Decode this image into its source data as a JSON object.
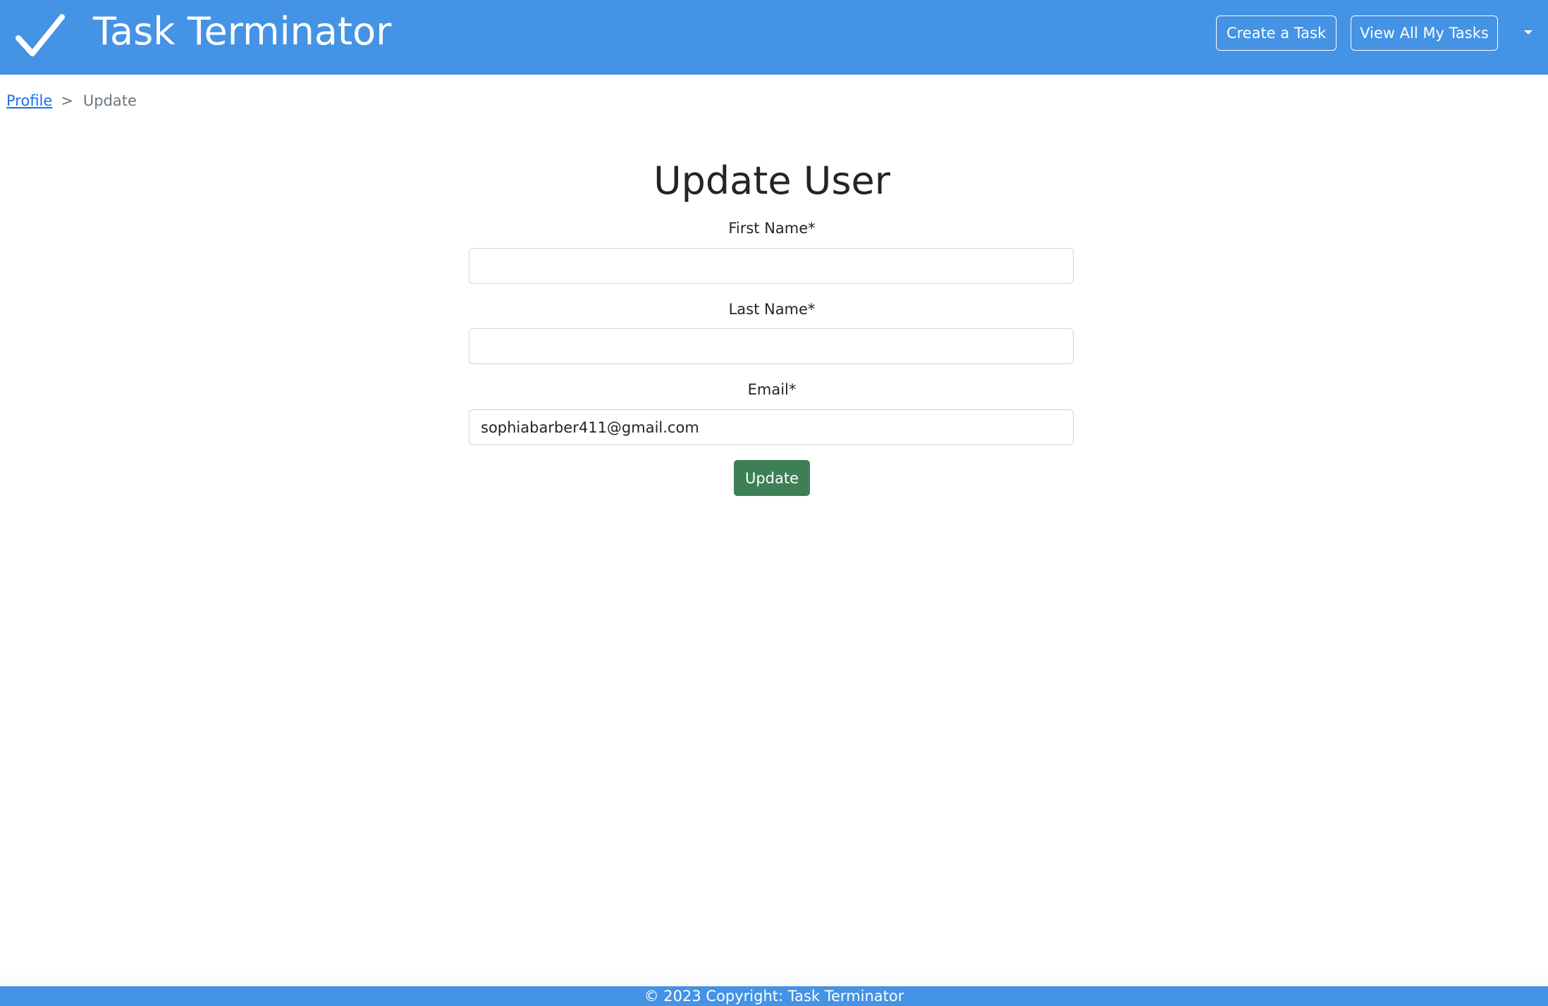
{
  "header": {
    "brand_icon": "checkmark-icon",
    "title": "Task Terminator",
    "create_task_label": "Create a Task",
    "view_all_label": "View All My Tasks",
    "dropdown_icon": "caret-down-icon"
  },
  "breadcrumb": {
    "link_label": "Profile",
    "separator": ">",
    "current": "Update"
  },
  "form": {
    "title": "Update User",
    "first_name_label": "First Name*",
    "first_name_value": "",
    "last_name_label": "Last Name*",
    "last_name_value": "",
    "email_label": "Email*",
    "email_value": "sophiabarber411@gmail.com",
    "submit_label": "Update"
  },
  "footer": {
    "text": "© 2023 Copyright: Task Terminator"
  },
  "colors": {
    "primary": "#4493e4",
    "submit": "#3e7f55",
    "link": "#1b6ef3"
  }
}
